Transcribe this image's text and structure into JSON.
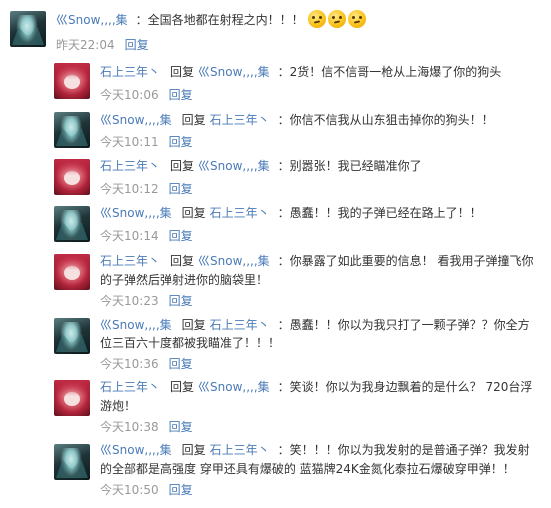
{
  "top": {
    "author": "巛Snow,,,,集",
    "text": "：全国各地都在射程之内！！！",
    "emojis": [
      "thinking-emoji",
      "thinking-emoji",
      "thinking-emoji"
    ],
    "time": "昨天22:04",
    "reply": "回复"
  },
  "reply_label": "回复",
  "replies": [
    {
      "author": "石上三年丶",
      "target": "巛Snow,,,,集",
      "avatar": "girl-avatar",
      "text": "：2货！信不信哥一枪从上海爆了你的狗头",
      "text2": "",
      "time": "今天10:06"
    },
    {
      "author": "巛Snow,,,,集",
      "target": "石上三年丶",
      "avatar": "miku-avatar",
      "text": "：你信不信我从山东狙击掉你的狗头！！",
      "text2": "",
      "time": "今天10:11"
    },
    {
      "author": "石上三年丶",
      "target": "巛Snow,,,,集",
      "avatar": "girl-avatar",
      "text": "：别嚣张！我已经瞄准你了",
      "text2": "",
      "time": "今天10:12"
    },
    {
      "author": "巛Snow,,,,集",
      "target": "石上三年丶",
      "avatar": "miku-avatar",
      "text": "：愚蠢！！我的子弹已经在路上了！！",
      "text2": "",
      "time": "今天10:14"
    },
    {
      "author": "石上三年丶",
      "target": "巛Snow,,,,集",
      "avatar": "girl-avatar",
      "text": "：你暴露了如此重要的信息！ 看我用子弹撞飞你",
      "text2": "的子弹然后弹射进你的脑袋里！",
      "time": "今天10:23"
    },
    {
      "author": "巛Snow,,,,集",
      "target": "石上三年丶",
      "avatar": "miku-avatar",
      "text": "：愚蠢！！你以为我只打了一颗子弹？？你全方",
      "text2": "位三百六十度都被我瞄准了！！！",
      "time": "今天10:36"
    },
    {
      "author": "石上三年丶",
      "target": "巛Snow,,,,集",
      "avatar": "girl-avatar",
      "text": "：笑谈！你以为我身边飘着的是什么？ 720台浮",
      "text2": "游炮！",
      "time": "今天10:38"
    },
    {
      "author": "巛Snow,,,,集",
      "target": "石上三年丶",
      "avatar": "miku-avatar",
      "text": "：笑！！！你以为我发射的是普通子弹？我发射",
      "text2": "的全部都是高强度 穿甲还具有爆破的 蓝猫牌24K金氮化泰拉石爆破穿甲弹！！",
      "time": "今天10:50"
    }
  ]
}
